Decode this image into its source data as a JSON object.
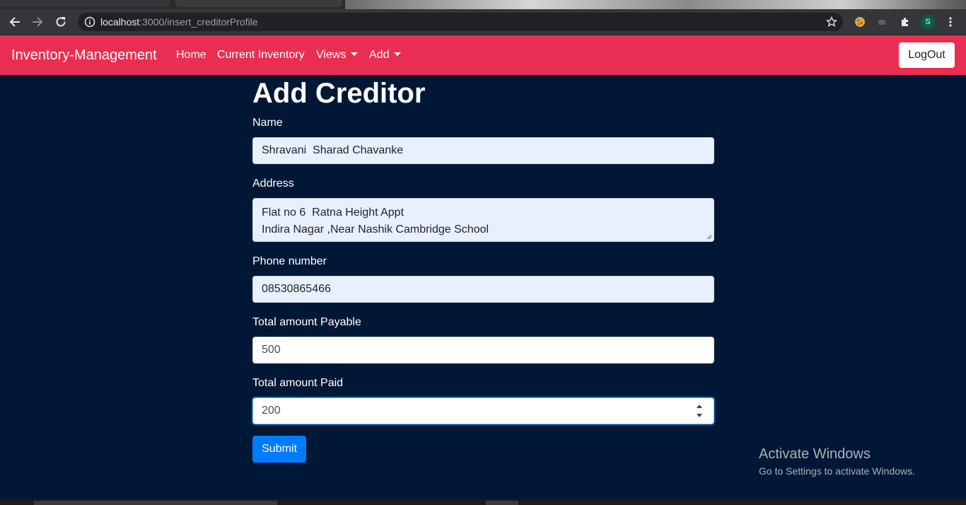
{
  "browser": {
    "url_host": "localhost",
    "url_path": ":3000/insert_creditorProfile",
    "profile_initial": "S"
  },
  "navbar": {
    "brand": "Inventory-Management",
    "links": [
      "Home",
      "Current Inventory",
      "Views",
      "Add"
    ],
    "logout_label": "LogOut"
  },
  "form": {
    "title": "Add Creditor",
    "name_label": "Name",
    "name_value": "Shravani  Sharad Chavanke",
    "address_label": "Address",
    "address_value": "Flat no 6  Ratna Height Appt\nIndira Nagar ,Near Nashik Cambridge School",
    "phone_label": "Phone number",
    "phone_value": "08530865466",
    "payable_label": "Total amount Payable",
    "payable_value": "500",
    "paid_label": "Total amount Paid",
    "paid_value": "200",
    "submit_label": "Submit"
  },
  "watermark": {
    "line1": "Activate Windows",
    "line2": "Go to Settings to activate Windows."
  },
  "colors": {
    "navbar": "#ea2e52",
    "background": "#001835",
    "primary": "#007bff"
  }
}
